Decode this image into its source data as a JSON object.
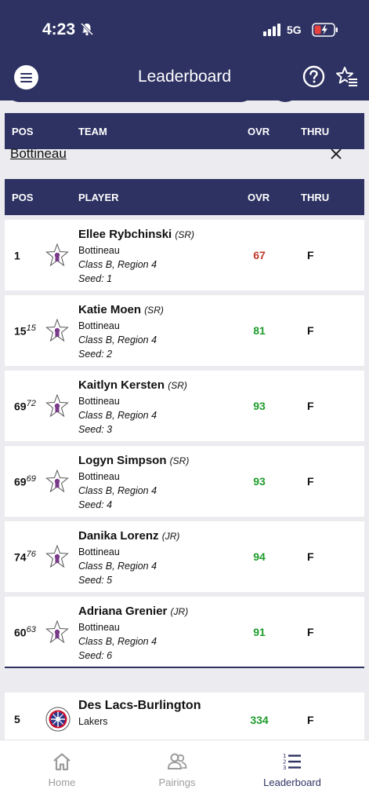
{
  "status_bar": {
    "time": "4:23",
    "network": "5G"
  },
  "app_bar": {
    "title": "Leaderboard"
  },
  "team_header": {
    "pos": "POS",
    "team": "TEAM",
    "ovr": "OVR",
    "thru": "THRU"
  },
  "filter": {
    "school": "Bottineau"
  },
  "player_header": {
    "pos": "POS",
    "player": "PLAYER",
    "ovr": "OVR",
    "thru": "THRU"
  },
  "players": [
    {
      "pos": "1",
      "prev": "",
      "name": "Ellee Rybchinski",
      "class": "(SR)",
      "team": "Bottineau",
      "division": "Class B, Region 4",
      "seed": "Seed: 1",
      "ovr": "67",
      "thru": "F"
    },
    {
      "pos": "15",
      "prev": "15",
      "name": "Katie Moen",
      "class": "(SR)",
      "team": "Bottineau",
      "division": "Class B, Region 4",
      "seed": "Seed: 2",
      "ovr": "81",
      "thru": "F"
    },
    {
      "pos": "69",
      "prev": "72",
      "name": "Kaitlyn Kersten",
      "class": "(SR)",
      "team": "Bottineau",
      "division": "Class B, Region 4",
      "seed": "Seed: 3",
      "ovr": "93",
      "thru": "F"
    },
    {
      "pos": "69",
      "prev": "69",
      "name": "Logyn Simpson",
      "class": "(SR)",
      "team": "Bottineau",
      "division": "Class B, Region 4",
      "seed": "Seed: 4",
      "ovr": "93",
      "thru": "F"
    },
    {
      "pos": "74",
      "prev": "76",
      "name": "Danika Lorenz",
      "class": "(JR)",
      "team": "Bottineau",
      "division": "Class B, Region 4",
      "seed": "Seed: 5",
      "ovr": "94",
      "thru": "F"
    },
    {
      "pos": "60",
      "prev": "63",
      "name": "Adriana Grenier",
      "class": "(JR)",
      "team": "Bottineau",
      "division": "Class B, Region 4",
      "seed": "Seed: 6",
      "ovr": "91",
      "thru": "F"
    }
  ],
  "team_row": {
    "pos": "5",
    "name": "Des Lacs-Burlington",
    "subtitle": "Lakers",
    "ovr": "334",
    "thru": "F"
  },
  "bottom_nav": [
    {
      "label": "Home",
      "icon": "home-icon",
      "active": false
    },
    {
      "label": "Pairings",
      "icon": "pairings-icon",
      "active": false
    },
    {
      "label": "Leaderboard",
      "icon": "leaderboard-icon",
      "active": true
    }
  ],
  "colors": {
    "primary": "#2e3262",
    "score_red": "#c0392b",
    "score_green": "#1f9d2c",
    "inactive": "#9c9c9c"
  }
}
